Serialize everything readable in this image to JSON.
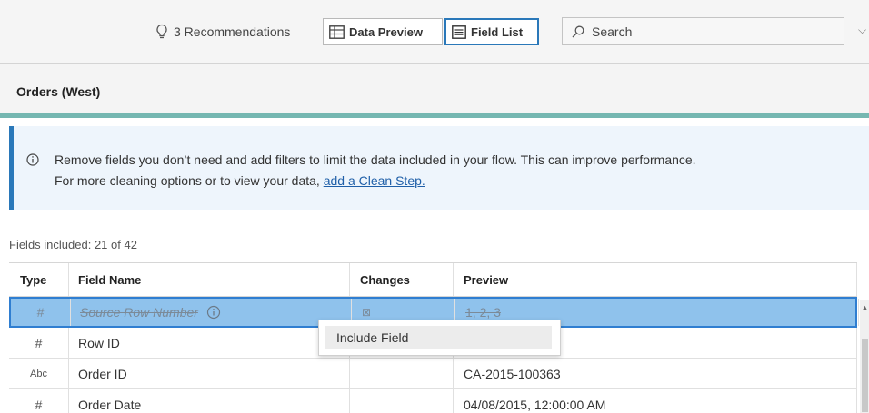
{
  "toolbar": {
    "recommendations": "3 Recommendations",
    "data_preview": "Data Preview",
    "field_list": "Field List",
    "search_placeholder": "Search"
  },
  "step_title": "Orders (West)",
  "banner": {
    "line1": "Remove fields you don’t need and add filters to limit the data included in your flow. This can improve performance.",
    "line2_prefix": "For more cleaning options or to view your data, ",
    "link": "add a Clean Step."
  },
  "fields_included": "Fields included: 21 of 42",
  "table": {
    "headers": {
      "type": "Type",
      "field_name": "Field Name",
      "changes": "Changes",
      "preview": "Preview"
    },
    "rows": [
      {
        "type": "#",
        "name": "Source Row Number",
        "changes": "⊠",
        "preview": "1, 2, 3"
      },
      {
        "type": "#",
        "name": "Row ID",
        "changes": "",
        "preview": ""
      },
      {
        "type": "Abc",
        "name": "Order ID",
        "changes": "",
        "preview": "CA-2015-100363"
      },
      {
        "type": "#",
        "name": "Order Date",
        "changes": "",
        "preview": "04/08/2015, 12:00:00 AM"
      }
    ]
  },
  "context_menu": {
    "item": "Include Field"
  },
  "colors": {
    "accent": "#2a78b9",
    "selected_row": "#8fc2ec",
    "teal_bar": "#75b7b1"
  }
}
